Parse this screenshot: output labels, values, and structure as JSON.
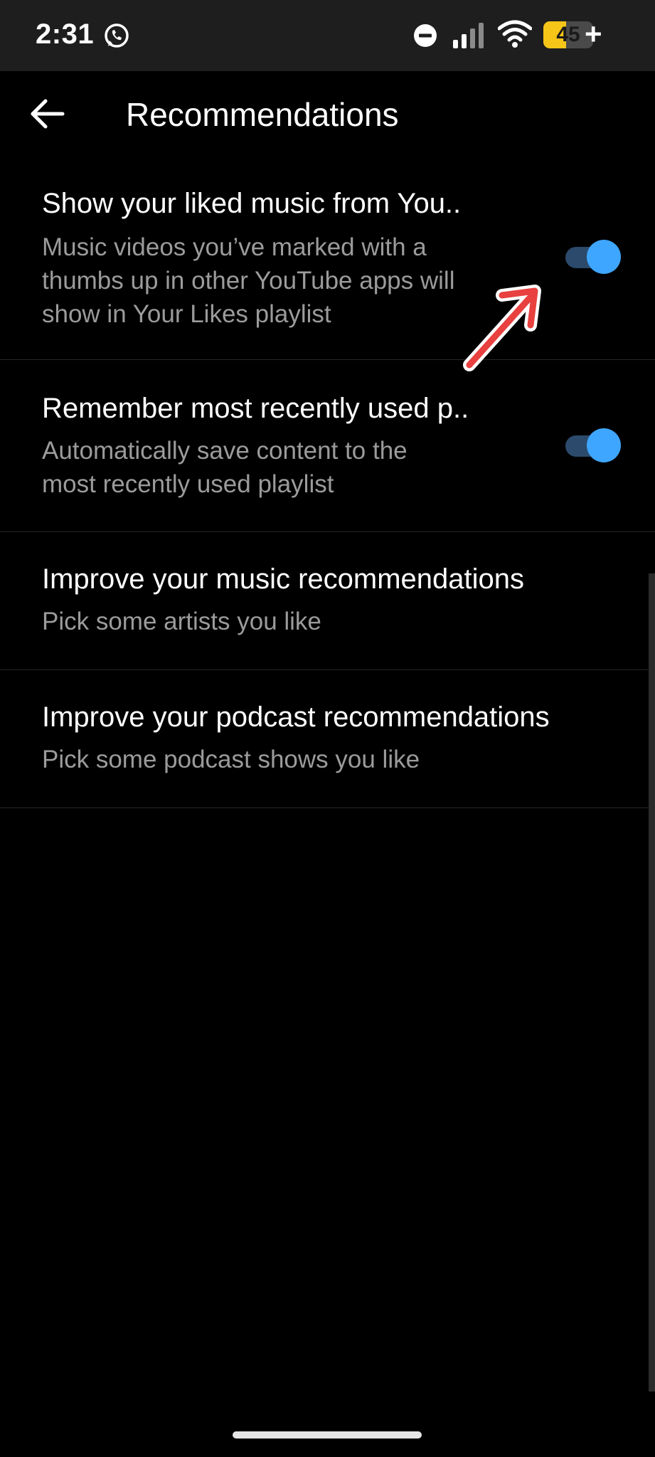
{
  "status_bar": {
    "time": "2:31",
    "battery_level": "45",
    "battery_fraction": 0.45,
    "battery_charging_symbol": "+",
    "icons": [
      "whatsapp-icon",
      "do-not-disturb-icon",
      "signal-icon",
      "wifi-icon",
      "battery-icon"
    ]
  },
  "header": {
    "back_icon": "arrow-left-icon",
    "title": "Recommendations"
  },
  "settings": [
    {
      "title": "Show your liked music from You..",
      "subtitle_lines": [
        "Music videos you’ve marked with a",
        "thumbs up in other YouTube apps will",
        "show in Your Likes playlist"
      ],
      "toggle": true
    },
    {
      "title": "Remember most recently used p..",
      "subtitle_lines": [
        "Automatically save content to the",
        "most recently used playlist"
      ],
      "toggle": true
    },
    {
      "title": "Improve your music recommendations",
      "subtitle_lines": [
        "Pick some artists you like"
      ]
    },
    {
      "title": "Improve your podcast recommendations",
      "subtitle_lines": [
        "Pick some podcast shows you like"
      ]
    }
  ],
  "colors": {
    "background": "#000000",
    "status_bar": "#1e1e1e",
    "toggle_knob": "#3ea6ff",
    "toggle_track": "#2c4a6b",
    "subtitle": "#9b9b9b",
    "annotation": "#e8413f",
    "battery": "#f5c518"
  },
  "annotation": {
    "icon": "red-arrow-icon",
    "points_to": "liked-music-toggle"
  }
}
